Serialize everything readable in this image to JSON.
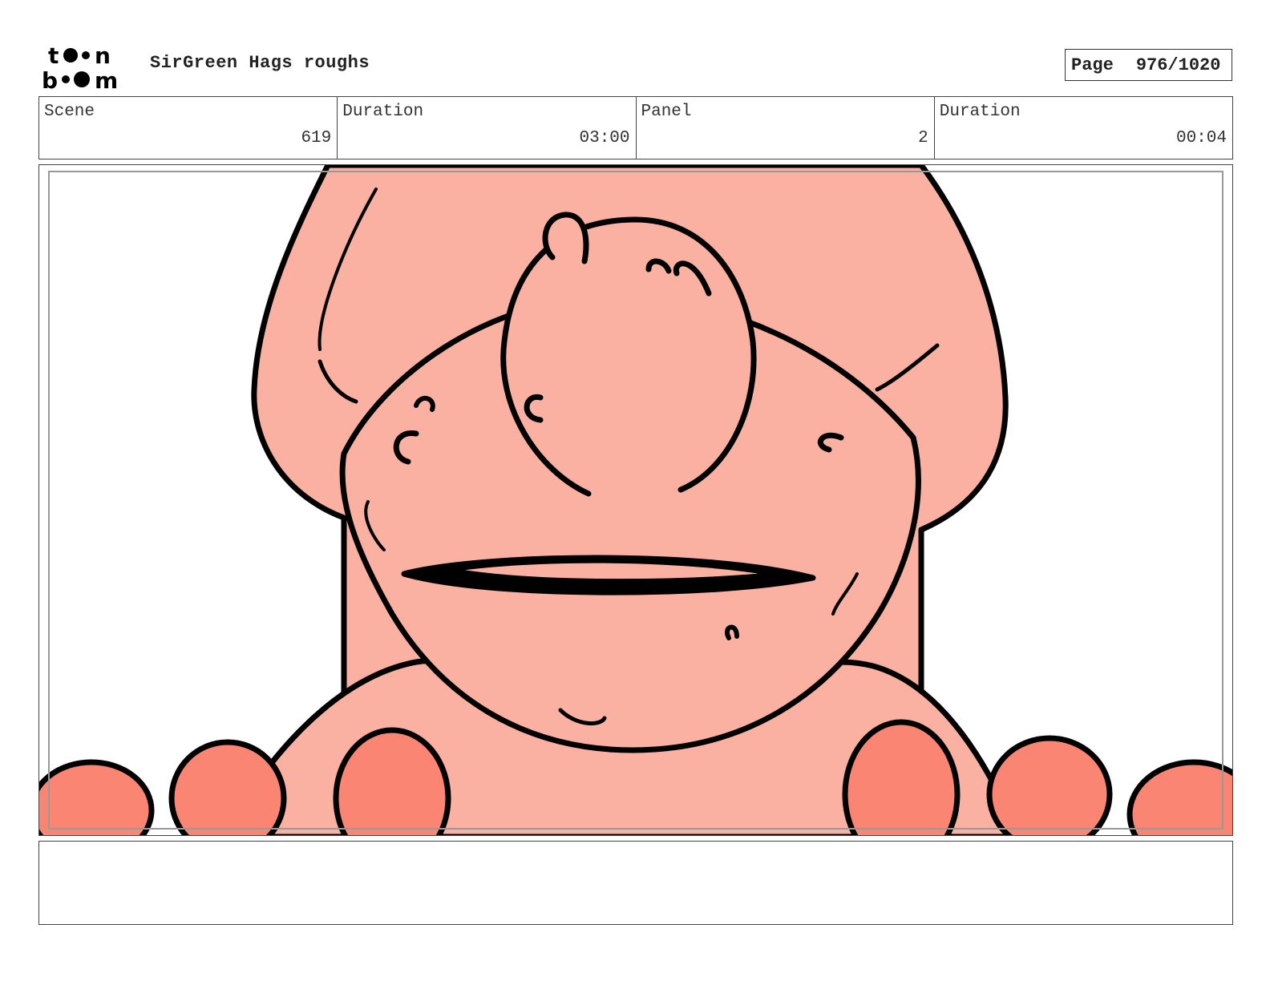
{
  "header": {
    "logo_text": "toon boom",
    "title": "SirGreen Hags roughs",
    "page_label": "Page",
    "page_number": "976/1020"
  },
  "info": {
    "scene_label": "Scene",
    "scene_value": "619",
    "scene_duration_label": "Duration",
    "scene_duration_value": "03:00",
    "panel_label": "Panel",
    "panel_value": "2",
    "panel_duration_label": "Duration",
    "panel_duration_value": "00:04"
  },
  "colors": {
    "skin": "#fbb1a1",
    "hand": "#fa8573",
    "outline": "#000000"
  },
  "notes": {
    "text": ""
  }
}
